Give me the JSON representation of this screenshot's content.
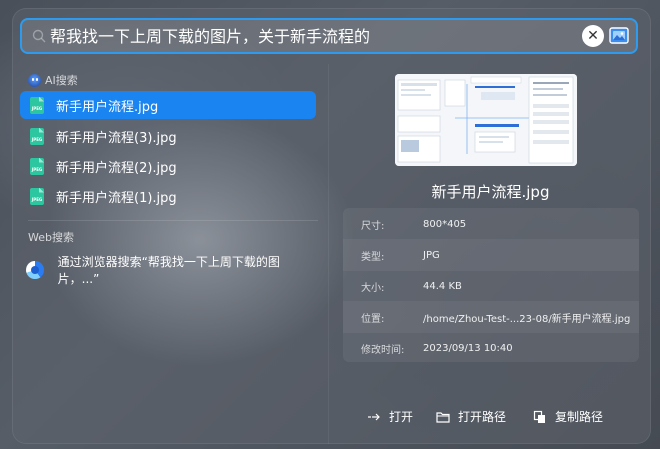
{
  "search": {
    "query": "帮我找一下上周下载的图片，关于新手流程的",
    "clear_symbol": "✕"
  },
  "ai_section": {
    "label": "AI搜索",
    "results": [
      {
        "name": "新手用户流程.jpg",
        "icon_text": "JPEG",
        "selected": true
      },
      {
        "name": "新手用户流程(3).jpg",
        "icon_text": "JPEG",
        "selected": false
      },
      {
        "name": "新手用户流程(2).jpg",
        "icon_text": "JPEG",
        "selected": false
      },
      {
        "name": "新手用户流程(1).jpg",
        "icon_text": "JPEG",
        "selected": false
      }
    ]
  },
  "web_section": {
    "label": "Web搜索",
    "item": "通过浏览器搜索“帮我找一下上周下载的图片，...”"
  },
  "preview": {
    "title": "新手用户流程.jpg",
    "details": [
      {
        "key": "尺寸:",
        "value": "800*405"
      },
      {
        "key": "类型:",
        "value": "JPG"
      },
      {
        "key": "大小:",
        "value": "44.4 KB"
      },
      {
        "key": "位置:",
        "value": "/home/Zhou-Test-...23-08/新手用户流程.jpg"
      },
      {
        "key": "修改时间:",
        "value": "2023/09/13 10:40"
      }
    ]
  },
  "actions": {
    "open": "打开",
    "open_path": "打开路径",
    "copy_path": "复制路径"
  },
  "colors": {
    "accent": "#1a84f0",
    "focus_border": "#2d9cf0",
    "file_icon": "#2cc7a0"
  }
}
